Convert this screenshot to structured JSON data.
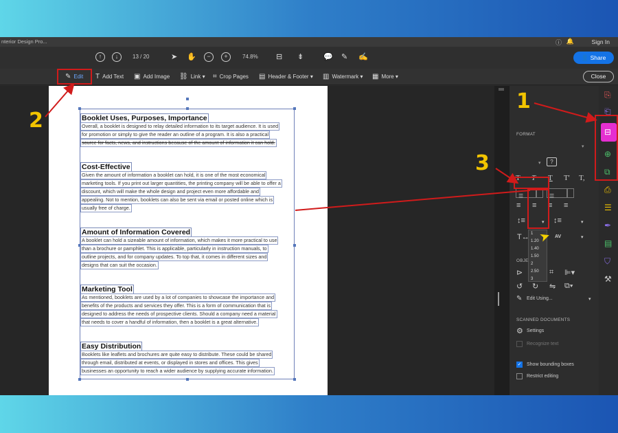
{
  "titlebar": {
    "doc_title": "nterior Design Pro...",
    "sign_in": "Sign In"
  },
  "toolbar": {
    "page_current": "13",
    "page_separator": "/",
    "page_total": "20",
    "zoom": "74.8%",
    "share": "Share"
  },
  "edit_toolbar": {
    "edit": "Edit",
    "add_text": "Add Text",
    "add_image": "Add Image",
    "link": "Link",
    "crop_pages": "Crop Pages",
    "header_footer": "Header & Footer",
    "watermark": "Watermark",
    "more": "More",
    "close": "Close"
  },
  "document": {
    "sections": [
      {
        "heading": "Booklet Uses, Purposes, Importance",
        "lines": [
          "Overall, a booklet is designed to relay detailed information to its target audience. It is used",
          "for promotion or simply to give the reader an outline of a program. It is also a practical",
          "source for facts, news, and instructions because of the amount of information it can hold."
        ]
      },
      {
        "heading": "Cost-Effective",
        "lines": [
          "Given the amount of information a booklet can hold, it is one of the most economical",
          "marketing tools. If you print out larger quantities, the printing company will be able to offer a",
          "discount, which will make the whole design and project even more affordable and",
          "appealing. Not to mention, booklets can also be sent via email or posted online which is",
          "usually free of charge."
        ]
      },
      {
        "heading": "Amount of Information Covered",
        "lines": [
          "A booklet can hold a sizeable amount of information, which makes it more practical to use",
          "than a brochure or pamphlet. This is applicable, particularly in instruction manuals, to",
          "outline projects, and for company updates. To top that, it comes in different sizes and",
          "designs that can suit the occasion."
        ]
      },
      {
        "heading": "Marketing Tool",
        "lines": [
          "As mentioned, booklets are used by a lot of companies to showcase the importance and",
          "benefits of the products and services they offer. This is a form of communication that is",
          "designed to address the needs of prospective clients. Should a company need a material",
          "that needs to cover a handful of information, then a booklet is a great alternative."
        ]
      },
      {
        "heading": "Easy Distribution",
        "lines": [
          "Booklets like leaflets and brochures are quite easy to distribute. These could be shared",
          "through email, distributed at events, or displayed in stores and offices. This gives",
          "businesses an opportunity to reach a wider audience by supplying accurate information."
        ]
      }
    ]
  },
  "panel": {
    "format_label": "FORMAT",
    "objects_label": "OBJE",
    "line_spacing_options": [
      "1",
      "1.20",
      "1.40",
      "1.50",
      "2",
      "2.50",
      "3"
    ],
    "edit_using": "Edit Using...",
    "scanned_label": "SCANNED DOCUMENTS",
    "settings": "Settings",
    "recognize_text": "Recognize text",
    "show_bounding_boxes": "Show bounding boxes",
    "show_bounding_boxes_checked": true,
    "restrict_editing": "Restrict editing",
    "restrict_editing_checked": false,
    "char_spacing_label": "AV"
  },
  "annotations": {
    "step1": "1",
    "step2": "2",
    "step3": "3"
  },
  "colors": {
    "accent": "#1473e6",
    "annotation": "#f2c400",
    "highlight": "#d11b1b",
    "rail_active": "#e52fd1"
  }
}
